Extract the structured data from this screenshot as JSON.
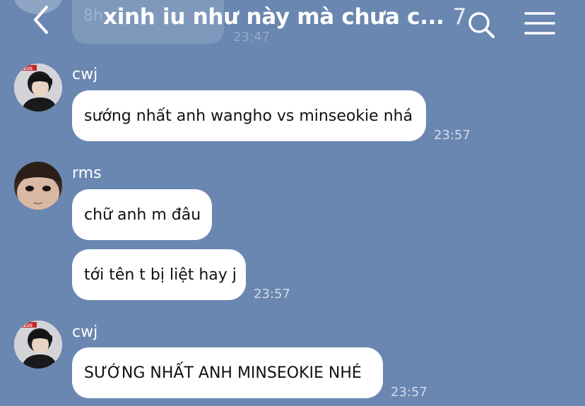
{
  "header": {
    "title": "xinh iu như này mà chưa c...",
    "member_count": "7",
    "icons": {
      "back": "chevron-left-icon",
      "search": "search-icon",
      "menu": "hamburger-menu-icon"
    }
  },
  "ghost": {
    "text": "8h",
    "time": "23:47"
  },
  "messages": [
    {
      "sender": "cwj",
      "text": "sướng nhất anh wangho vs minseokie nhá",
      "time": "23:57"
    },
    {
      "sender": "rms",
      "text": "chữ anh m đâu",
      "time": ""
    },
    {
      "sender": "",
      "text": "tới tên t bị liệt hay j",
      "time": "23:57"
    },
    {
      "sender": "cwj",
      "text": "SƯỚNG NHẤT ANH MINSEOKIE NHÉ",
      "time": "23:57"
    }
  ],
  "colors": {
    "background": "#6a87b1",
    "bubble": "#ffffff",
    "text": "#111111",
    "header_text": "#ffffff"
  },
  "avatar_badge": "ZEUS"
}
